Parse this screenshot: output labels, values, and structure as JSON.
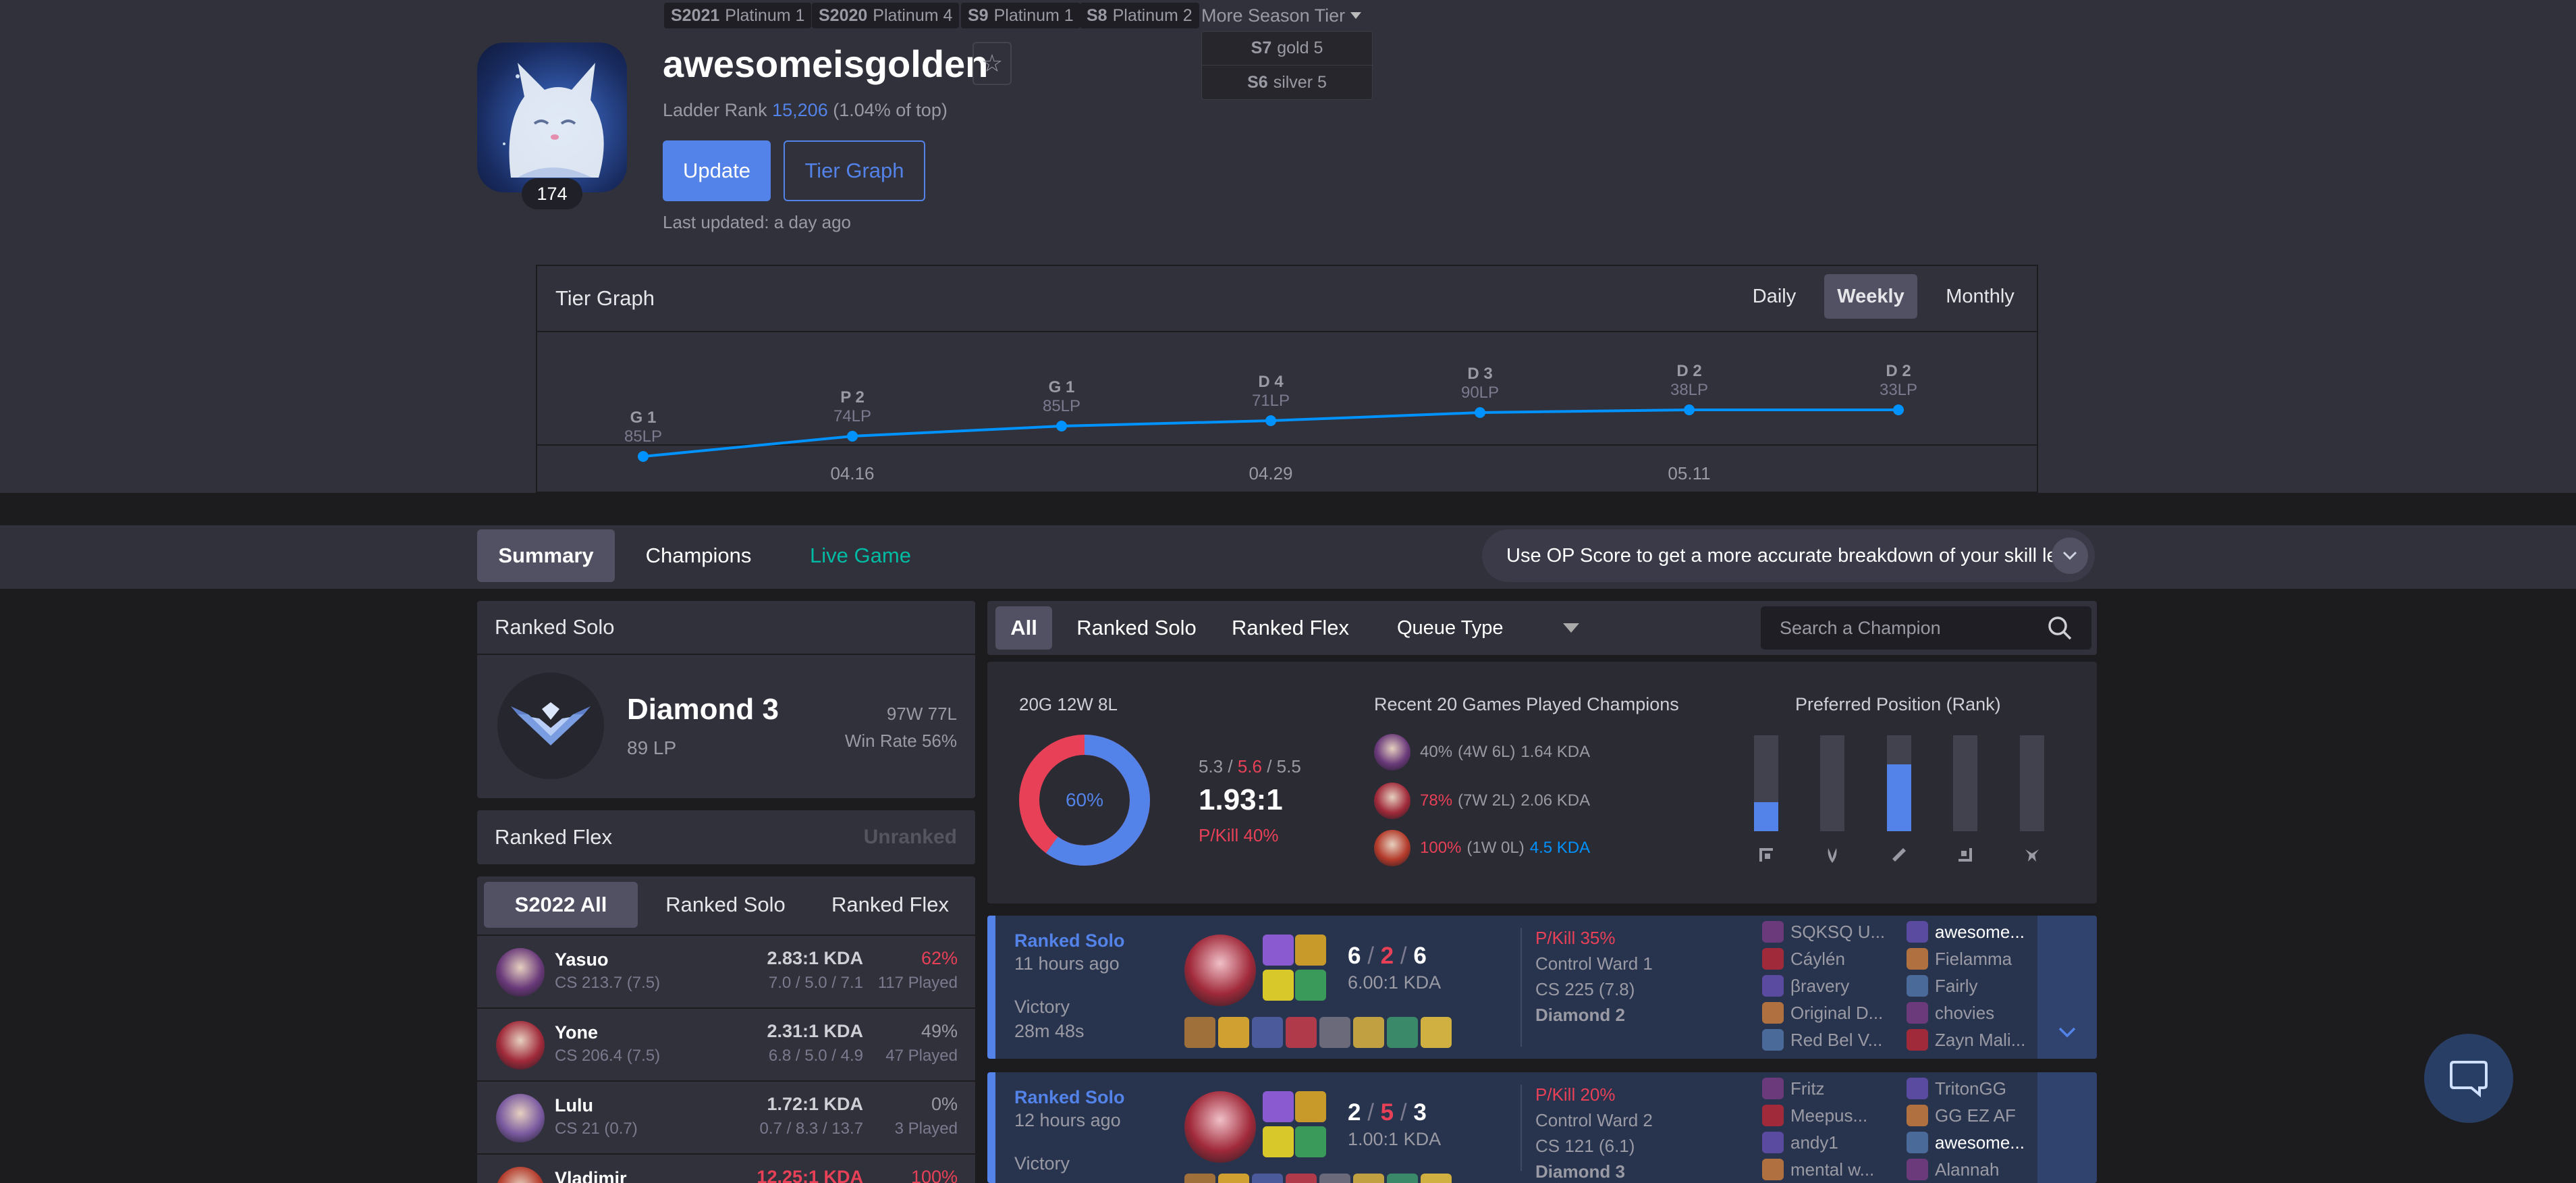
{
  "season_badges": [
    {
      "season": "S2021",
      "tier": "Platinum 1"
    },
    {
      "season": "S2020",
      "tier": "Platinum 4"
    },
    {
      "season": "S9",
      "tier": "Platinum 1"
    },
    {
      "season": "S8",
      "tier": "Platinum 2"
    }
  ],
  "more_season_label": "More Season Tier",
  "season_dropdown": [
    {
      "season": "S7",
      "tier": "gold 5"
    },
    {
      "season": "S6",
      "tier": "silver 5"
    }
  ],
  "profile": {
    "level": "174",
    "name": "awesomeisgolden",
    "ladder_prefix": "Ladder Rank",
    "ladder_rank": "15,206",
    "ladder_pct": "(1.04% of top)",
    "update_label": "Update",
    "tier_graph_label": "Tier Graph",
    "last_updated": "Last updated: a day ago"
  },
  "tier_graph": {
    "title": "Tier Graph",
    "periods": [
      "Daily",
      "Weekly",
      "Monthly"
    ],
    "selected_period": "Weekly",
    "points": [
      {
        "tier": "G 1",
        "lp": "85LP"
      },
      {
        "tier": "P 2",
        "lp": "74LP"
      },
      {
        "tier": "G 1",
        "lp": "85LP"
      },
      {
        "tier": "D 4",
        "lp": "71LP"
      },
      {
        "tier": "D 3",
        "lp": "90LP"
      },
      {
        "tier": "D 2",
        "lp": "38LP"
      },
      {
        "tier": "D 2",
        "lp": "33LP"
      }
    ],
    "date_labels": [
      "04.16",
      "04.29",
      "05.11"
    ],
    "line_color": "#0093ff"
  },
  "nav": {
    "tabs": [
      "Summary",
      "Champions",
      "Live Game"
    ],
    "opscore_text": "Use OP Score to get a more accurate breakdown of your skill level."
  },
  "ranked_solo": {
    "title": "Ranked Solo",
    "tier": "Diamond 3",
    "lp": "89 LP",
    "wl": "97W 77L",
    "win_rate": "Win Rate 56%"
  },
  "ranked_flex": {
    "title": "Ranked Flex",
    "status": "Unranked"
  },
  "champ_tabs": [
    "S2022 All",
    "Ranked Solo",
    "Ranked Flex"
  ],
  "champions": [
    {
      "name": "Yasuo",
      "cs": "CS 213.7 (7.5)",
      "kda": "2.83:1 KDA",
      "kda_detail": "7.0 / 5.0 / 7.1",
      "wr": "62%",
      "played": "117 Played",
      "kda_color": "#cfcfd6",
      "wr_color": "#e84057",
      "color": "#6a3a7a"
    },
    {
      "name": "Yone",
      "cs": "CS 206.4 (7.5)",
      "kda": "2.31:1 KDA",
      "kda_detail": "6.8 / 5.0 / 4.9",
      "wr": "49%",
      "played": "47 Played",
      "kda_color": "#cfcfd6",
      "wr_color": "#9a9aa4",
      "color": "#a02a3a"
    },
    {
      "name": "Lulu",
      "cs": "CS 21 (0.7)",
      "kda": "1.72:1 KDA",
      "kda_detail": "0.7 / 8.3 / 13.7",
      "wr": "0%",
      "played": "3 Played",
      "kda_color": "#cfcfd6",
      "wr_color": "#9a9aa4",
      "color": "#7a5aa0"
    },
    {
      "name": "Vladimir",
      "cs": "",
      "kda": "12.25:1 KDA",
      "kda_detail": "",
      "wr": "100%",
      "played": "",
      "kda_color": "#e84057",
      "wr_color": "#e84057",
      "color": "#b33a2a"
    }
  ],
  "filters": {
    "tabs": [
      "All",
      "Ranked Solo",
      "Ranked Flex"
    ],
    "queue_type": "Queue Type",
    "search_placeholder": "Search a Champion"
  },
  "summary_stats": {
    "games": "20G 12W 8L",
    "win_pct": "60%",
    "win_fraction": 0.6,
    "kills": "5.3",
    "deaths": "5.6",
    "assists": "5.5",
    "kda_ratio": "1.93:1",
    "pkill": "P/Kill 40%",
    "recent_title": "Recent 20 Games Played Champions",
    "recent": [
      {
        "wr": "40%",
        "wl": "(4W 6L)",
        "kda": "1.64 KDA",
        "wr_color": "#9a9aa4",
        "kda_color": "#9a9aa4",
        "color": "#6a3a7a"
      },
      {
        "wr": "78%",
        "wl": "(7W 2L)",
        "kda": "2.06 KDA",
        "wr_color": "#e84057",
        "kda_color": "#9a9aa4",
        "color": "#a02a3a"
      },
      {
        "wr": "100%",
        "wl": "(1W 0L)",
        "kda": "4.5 KDA",
        "wr_color": "#e84057",
        "kda_color": "#0093ff",
        "color": "#b33a2a"
      }
    ],
    "pos_title": "Preferred Position (Rank)",
    "positions": [
      {
        "name": "top",
        "fraction": 0.3
      },
      {
        "name": "jungle",
        "fraction": 0.0
      },
      {
        "name": "mid",
        "fraction": 0.7
      },
      {
        "name": "adc",
        "fraction": 0.0
      },
      {
        "name": "support",
        "fraction": 0.0
      }
    ]
  },
  "matches": [
    {
      "queue": "Ranked Solo",
      "time": "11 hours ago",
      "result": "Victory",
      "duration": "28m 48s",
      "kills": "6",
      "deaths": "2",
      "assists": "6",
      "kda_ratio": "6.00:1 KDA",
      "pkill": "P/Kill 35%",
      "control_ward": "Control Ward 1",
      "cs": "CS 225 (7.8)",
      "rank": "Diamond 2",
      "team1": [
        "SQKSQ U...",
        "Cáylén",
        "βravery",
        "Original D...",
        "Red Bel V..."
      ],
      "team2": [
        "awesome...",
        "Fielamma",
        "Fairly",
        "chovies",
        "Zayn Mali..."
      ]
    },
    {
      "queue": "Ranked Solo",
      "time": "12 hours ago",
      "result": "Victory",
      "duration": "",
      "kills": "2",
      "deaths": "5",
      "assists": "3",
      "kda_ratio": "1.00:1 KDA",
      "pkill": "P/Kill 20%",
      "control_ward": "Control Ward 2",
      "cs": "CS 121 (6.1)",
      "rank": "Diamond 3",
      "team1": [
        "Fritz",
        "Meepus...",
        "andy1",
        "mental w..."
      ],
      "team2": [
        "TritonGG",
        "GG EZ AF",
        "awesome...",
        "Alannah"
      ]
    }
  ]
}
